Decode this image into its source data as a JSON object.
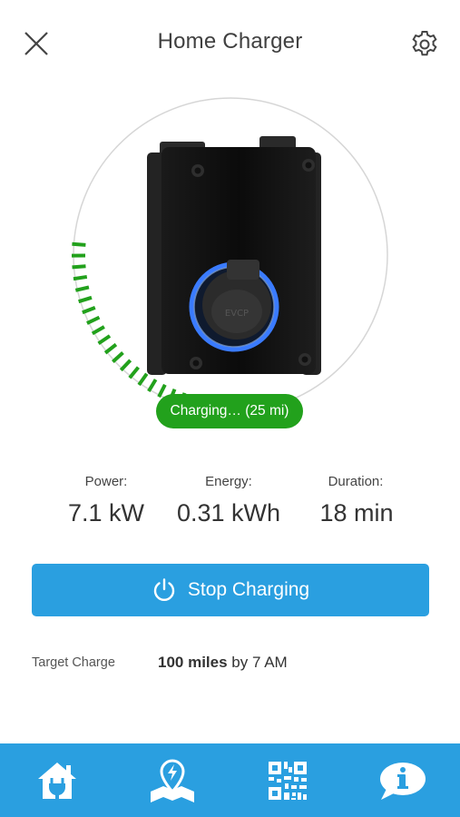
{
  "header": {
    "title": "Home Charger",
    "close_icon": "close-icon",
    "settings_icon": "gear-icon"
  },
  "charger": {
    "image": "wallbox-charger",
    "status_text": "Charging… (25 mi)",
    "progress_fraction": 0.25,
    "accent_color": "#22a11c"
  },
  "stats": [
    {
      "label": "Power:",
      "value": "7.1 kW"
    },
    {
      "label": "Energy:",
      "value": "0.31 kWh"
    },
    {
      "label": "Duration:",
      "value": "18 min"
    }
  ],
  "action": {
    "label": "Stop Charging",
    "icon": "power-icon",
    "color": "#2a9fe0"
  },
  "target": {
    "label": "Target Charge",
    "amount": "100 miles",
    "suffix": "by 7 AM"
  },
  "bottom_nav": {
    "items": [
      {
        "icon": "home-plug-icon"
      },
      {
        "icon": "map-pin-icon"
      },
      {
        "icon": "qr-code-icon"
      },
      {
        "icon": "info-chat-icon"
      }
    ],
    "color": "#2a9fe0"
  }
}
